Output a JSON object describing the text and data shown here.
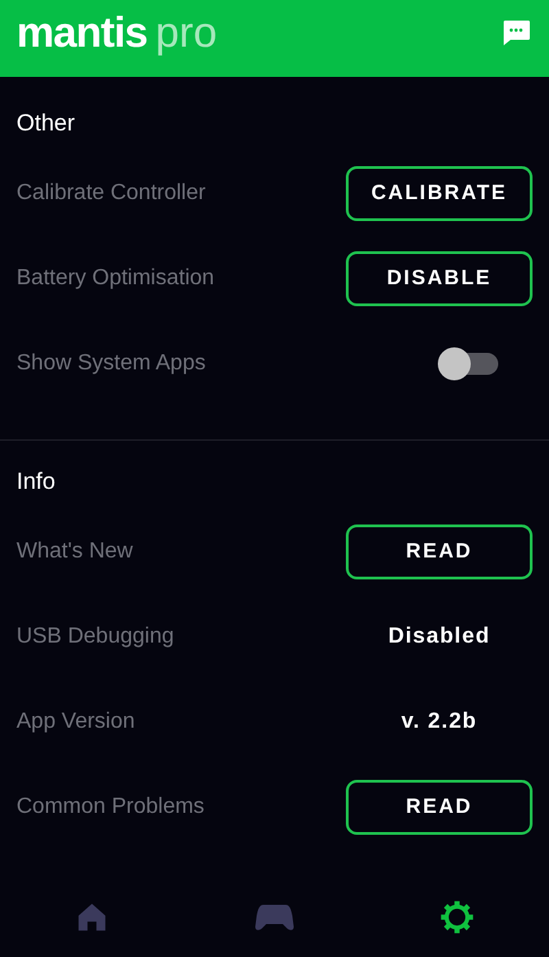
{
  "header": {
    "brand": "mantis",
    "brand_suffix": "pro"
  },
  "sections": [
    {
      "title": "Other",
      "rows": [
        {
          "kind": "button",
          "label": "Calibrate Controller",
          "action": "CALIBRATE"
        },
        {
          "kind": "button",
          "label": "Battery Optimisation",
          "action": "DISABLE"
        },
        {
          "kind": "toggle",
          "label": "Show System Apps",
          "on": false
        }
      ]
    },
    {
      "title": "Info",
      "rows": [
        {
          "kind": "button",
          "label": "What's New",
          "action": "READ"
        },
        {
          "kind": "value",
          "label": "USB Debugging",
          "value": "Disabled"
        },
        {
          "kind": "value",
          "label": "App Version",
          "value": "v. 2.2b"
        },
        {
          "kind": "button",
          "label": "Common Problems",
          "action": "READ"
        }
      ]
    }
  ],
  "nav": [
    {
      "kind": "home",
      "selected": false
    },
    {
      "kind": "gamepad",
      "selected": false
    },
    {
      "kind": "settings",
      "selected": true
    }
  ]
}
